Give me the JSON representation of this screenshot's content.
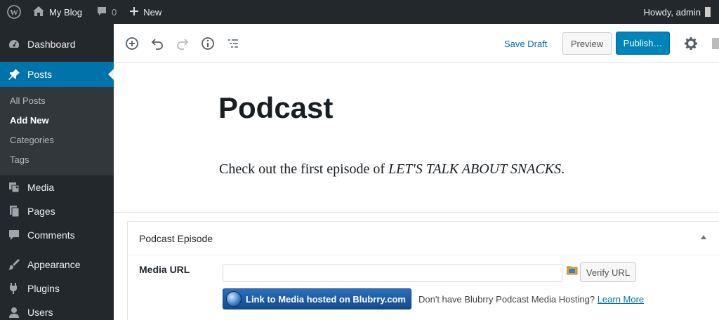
{
  "adminbar": {
    "site_name": "My Blog",
    "comments_count": "0",
    "new_label": "New",
    "howdy": "Howdy, admin"
  },
  "sidebar": {
    "items": [
      {
        "label": "Dashboard",
        "icon": "dashboard-icon"
      },
      {
        "label": "Posts",
        "icon": "pin-icon",
        "active": true
      },
      {
        "label": "Media",
        "icon": "media-icon"
      },
      {
        "label": "Pages",
        "icon": "pages-icon"
      },
      {
        "label": "Comments",
        "icon": "comment-icon"
      },
      {
        "label": "Appearance",
        "icon": "brush-icon"
      },
      {
        "label": "Plugins",
        "icon": "plugin-icon"
      },
      {
        "label": "Users",
        "icon": "users-icon"
      }
    ],
    "submenu": [
      "All Posts",
      "Add New",
      "Categories",
      "Tags"
    ],
    "submenu_current": "Add New"
  },
  "toolbar": {
    "save_draft": "Save Draft",
    "preview": "Preview",
    "publish": "Publish…"
  },
  "post": {
    "title": "Podcast",
    "body_prefix": "Check out the first episode of ",
    "body_emphasis": "LET'S TALK ABOUT SNACKS",
    "body_suffix": "."
  },
  "metabox": {
    "title": "Podcast Episode",
    "media_url_label": "Media URL",
    "media_url_value": "",
    "verify_button": "Verify URL",
    "blubrry_button": "Link to Media hosted on Blubrry.com",
    "hosting_text": "Don't have Blubrry Podcast Media Hosting?",
    "learn_more": "Learn More"
  },
  "colors": {
    "admin_dark": "#23282d",
    "accent_blue": "#0073aa",
    "publish_blue": "#0085ba"
  }
}
